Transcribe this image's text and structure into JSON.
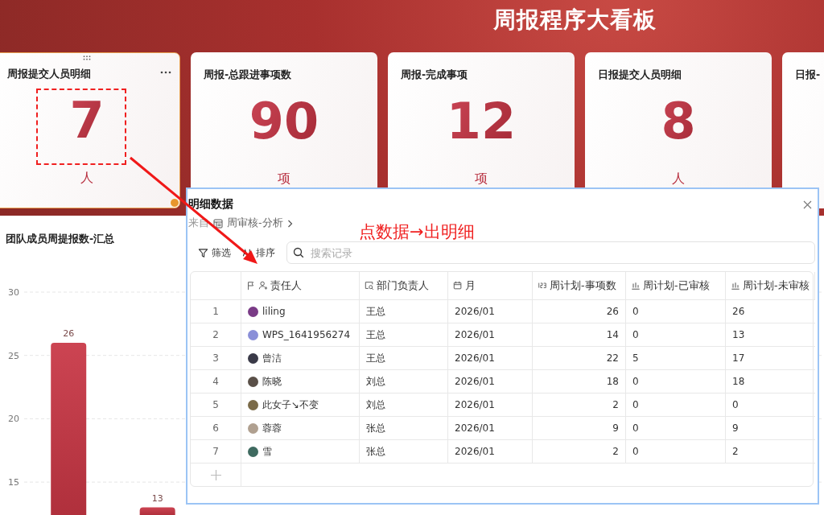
{
  "header": {
    "title": "周报程序大看板"
  },
  "cards": [
    {
      "title": "周报提交人员明细",
      "value": "7",
      "unit": "人",
      "selected": true
    },
    {
      "title": "周报-总跟进事项数",
      "value": "90",
      "unit": "项",
      "selected": false
    },
    {
      "title": "周报-完成事项",
      "value": "12",
      "unit": "项",
      "selected": false
    },
    {
      "title": "日报提交人员明细",
      "value": "8",
      "unit": "人",
      "selected": false
    },
    {
      "title": "日报-",
      "selected": false
    }
  ],
  "chart_panel": {
    "chart_data": {
      "type": "bar",
      "title": "团队成员周提报数-汇总",
      "values": [
        26,
        13,
        null,
        null,
        null,
        null,
        null,
        null,
        null
      ],
      "ylim": [
        12.4,
        30
      ],
      "grid": true,
      "yticks": [
        15,
        20,
        25,
        30
      ],
      "value_labels": [
        "26",
        "13",
        null,
        null,
        null,
        null,
        null,
        null,
        null
      ]
    }
  },
  "annotation": {
    "text": "点数据→出明细"
  },
  "detail_dialog": {
    "title": "明细数据",
    "source_label": "来自",
    "source_name": "周审核-分析",
    "toolbar": [
      {
        "kind": "filter",
        "label": "筛选"
      },
      {
        "kind": "sort",
        "label": "排序"
      }
    ],
    "search": {
      "placeholder": "搜索记录"
    },
    "columns": [
      {
        "kind": "person",
        "label": "责任人",
        "primary": true
      },
      {
        "kind": "lookup",
        "label": "部门负责人",
        "primary": false
      },
      {
        "kind": "date",
        "label": "月",
        "primary": false
      },
      {
        "kind": "number",
        "label": "周计划-事项数",
        "primary": false
      },
      {
        "kind": "formula",
        "label": "周计划-已审核",
        "primary": false
      },
      {
        "kind": "formula",
        "label": "周计划-未审核",
        "primary": false
      }
    ],
    "rows": [
      {
        "index": "1",
        "cells": [
          "liling",
          "王总",
          "2026/01",
          "26",
          "0",
          "26"
        ],
        "color": "#7a3b86"
      },
      {
        "index": "2",
        "cells": [
          "WPS_1641956274",
          "王总",
          "2026/01",
          "14",
          "0",
          "13"
        ],
        "color": "#8a8fd8"
      },
      {
        "index": "3",
        "cells": [
          "曾洁",
          "王总",
          "2026/01",
          "22",
          "5",
          "17"
        ],
        "color": "#3a3a48"
      },
      {
        "index": "4",
        "cells": [
          "陈晓",
          "刘总",
          "2026/01",
          "18",
          "0",
          "18"
        ],
        "color": "#5a5048"
      },
      {
        "index": "5",
        "cells": [
          "此女子↘不变",
          "刘总",
          "2026/01",
          "2",
          "0",
          "0"
        ],
        "color": "#7a6a48"
      },
      {
        "index": "6",
        "cells": [
          "蓉蓉",
          "张总",
          "2026/01",
          "9",
          "0",
          "9"
        ],
        "color": "#b0a090"
      },
      {
        "index": "7",
        "cells": [
          "雪",
          "张总",
          "2026/01",
          "2",
          "0",
          "2"
        ],
        "color": "#3f6a60"
      }
    ]
  }
}
